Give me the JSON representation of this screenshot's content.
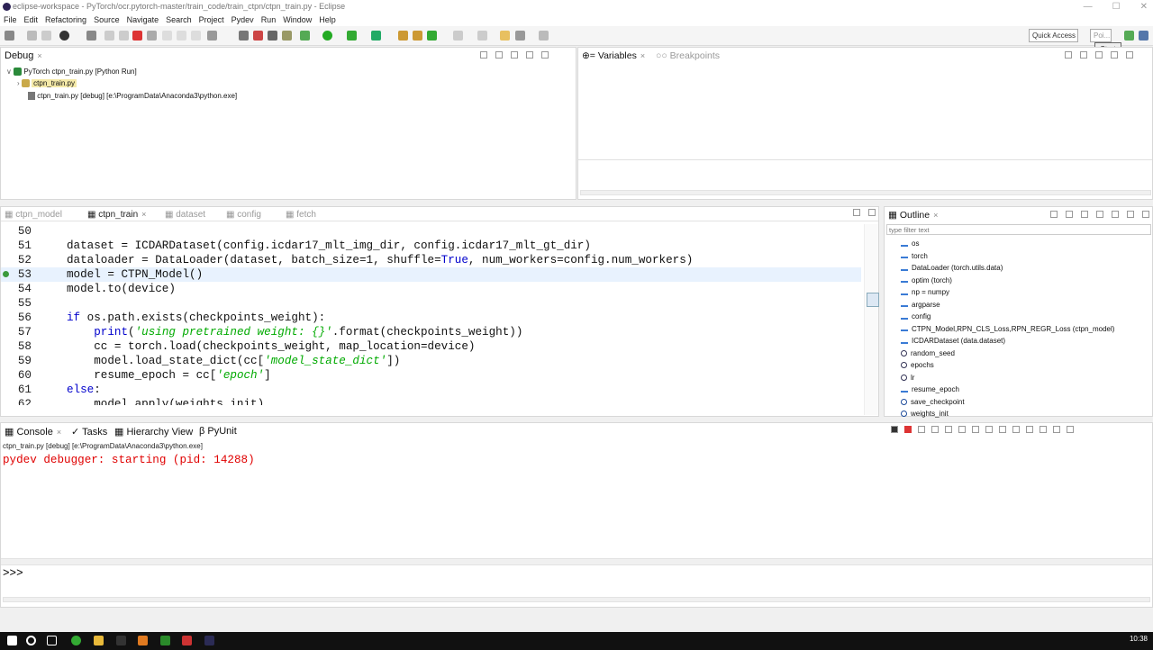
{
  "window": {
    "title": "eclipse-workspace - PyTorch/ocr.pytorch-master/train_code/train_ctpn/ctpn_train.py - Eclipse",
    "min_glyph": "—",
    "max_glyph": "☐",
    "close_glyph": "✕"
  },
  "menu": [
    "File",
    "Edit",
    "Refactoring",
    "Source",
    "Navigate",
    "Search",
    "Project",
    "Pydev",
    "Run",
    "Window",
    "Help"
  ],
  "toolbar": {
    "quick_access": "Quick Access",
    "start_label": "Start",
    "perspective_label": "Poi..."
  },
  "debug": {
    "title": "Debug",
    "close": "×",
    "items": [
      {
        "label": "PyTorch ctpn_train.py [Python Run]"
      },
      {
        "label": "ctpn_train.py"
      },
      {
        "label": "ctpn_train.py [debug] [e:\\ProgramData\\Anaconda3\\python.exe]"
      }
    ]
  },
  "variables": {
    "tab_variables": "Variables",
    "tab_breakpoints": "Breakpoints",
    "close": "×"
  },
  "editor": {
    "tabs": [
      {
        "label": "ctpn_model"
      },
      {
        "label": "ctpn_train"
      },
      {
        "label": "dataset"
      },
      {
        "label": "config"
      },
      {
        "label": "fetch"
      }
    ],
    "close": "×",
    "lines": [
      {
        "n": "50",
        "text": ""
      },
      {
        "n": "51",
        "text": "dataset = ICDARDataset(config.icdar17_mlt_img_dir, config.icdar17_mlt_gt_dir)"
      },
      {
        "n": "52",
        "text": "dataloader = DataLoader(dataset, batch_size=1, shuffle=True, num_workers=config.num_workers)"
      },
      {
        "n": "53",
        "text": "model = CTPN_Model()"
      },
      {
        "n": "54",
        "text": "model.to(device)"
      },
      {
        "n": "55",
        "text": ""
      },
      {
        "n": "56",
        "text": "if os.path.exists(checkpoints_weight):"
      },
      {
        "n": "57",
        "text": "    print('using pretrained weight: {}'.format(checkpoints_weight))"
      },
      {
        "n": "58",
        "text": "    cc = torch.load(checkpoints_weight, map_location=device)"
      },
      {
        "n": "59",
        "text": "    model.load_state_dict(cc['model_state_dict'])"
      },
      {
        "n": "60",
        "text": "    resume_epoch = cc['epoch']"
      },
      {
        "n": "61",
        "text": "else:"
      },
      {
        "n": "62",
        "text": "    model.apply(weights_init)"
      }
    ],
    "code_parts": {
      "l52_a": "dataloader = DataLoader(dataset, batch_size=1, shuffle=",
      "l52_kw": "True",
      "l52_b": ", num_workers=config.num_workers)",
      "l56_kw": "if",
      "l56_b": " os.path.exists(checkpoints_weight):",
      "l57_kw": "print",
      "l57_a": "    ",
      "l57_b": "(",
      "l57_str": "'using pretrained weight: {}'",
      "l57_c": ".format(checkpoints_weight))",
      "l59_a": "    model.load_state_dict(cc[",
      "l59_str": "'model_state_dict'",
      "l59_b": "])",
      "l60_a": "    resume_epoch = cc[",
      "l60_str": "'epoch'",
      "l60_b": "]",
      "l61_kw": "else",
      "l61_b": ":"
    }
  },
  "outline": {
    "title": "Outline",
    "close": "×",
    "filter_placeholder": "type filter text",
    "items": [
      {
        "label": "os",
        "icon": "import-icon"
      },
      {
        "label": "torch",
        "icon": "import-icon"
      },
      {
        "label": "DataLoader (torch.utils.data)",
        "icon": "import-icon"
      },
      {
        "label": "optim (torch)",
        "icon": "import-icon"
      },
      {
        "label": "np = numpy",
        "icon": "import-icon"
      },
      {
        "label": "argparse",
        "icon": "import-icon"
      },
      {
        "label": "config",
        "icon": "import-icon"
      },
      {
        "label": "CTPN_Model,RPN_CLS_Loss,RPN_REGR_Loss (ctpn_model)",
        "icon": "import-icon"
      },
      {
        "label": "ICDARDataset (data.dataset)",
        "icon": "import-icon"
      },
      {
        "label": "random_seed",
        "icon": "variable-icon"
      },
      {
        "label": "epochs",
        "icon": "variable-icon"
      },
      {
        "label": "lr",
        "icon": "variable-icon"
      },
      {
        "label": "resume_epoch",
        "icon": "import-icon"
      },
      {
        "label": "save_checkpoint",
        "icon": "function-icon"
      },
      {
        "label": "weights_init",
        "icon": "function-icon"
      }
    ]
  },
  "console": {
    "tabs": [
      {
        "label": "Console"
      },
      {
        "label": "Tasks"
      },
      {
        "label": "Hierarchy View"
      },
      {
        "label": "PyUnit"
      }
    ],
    "close": "×",
    "process": "ctpn_train.py [debug] [e:\\ProgramData\\Anaconda3\\python.exe]",
    "output": "pydev debugger: starting (pid: 14288)",
    "prompt": ">>>"
  },
  "taskbar": {
    "time": "10:38"
  },
  "colors": {
    "keyword": "#0000cc",
    "string": "#00aa00",
    "console_error": "#e00000",
    "current_line": "#e8f2fe"
  }
}
